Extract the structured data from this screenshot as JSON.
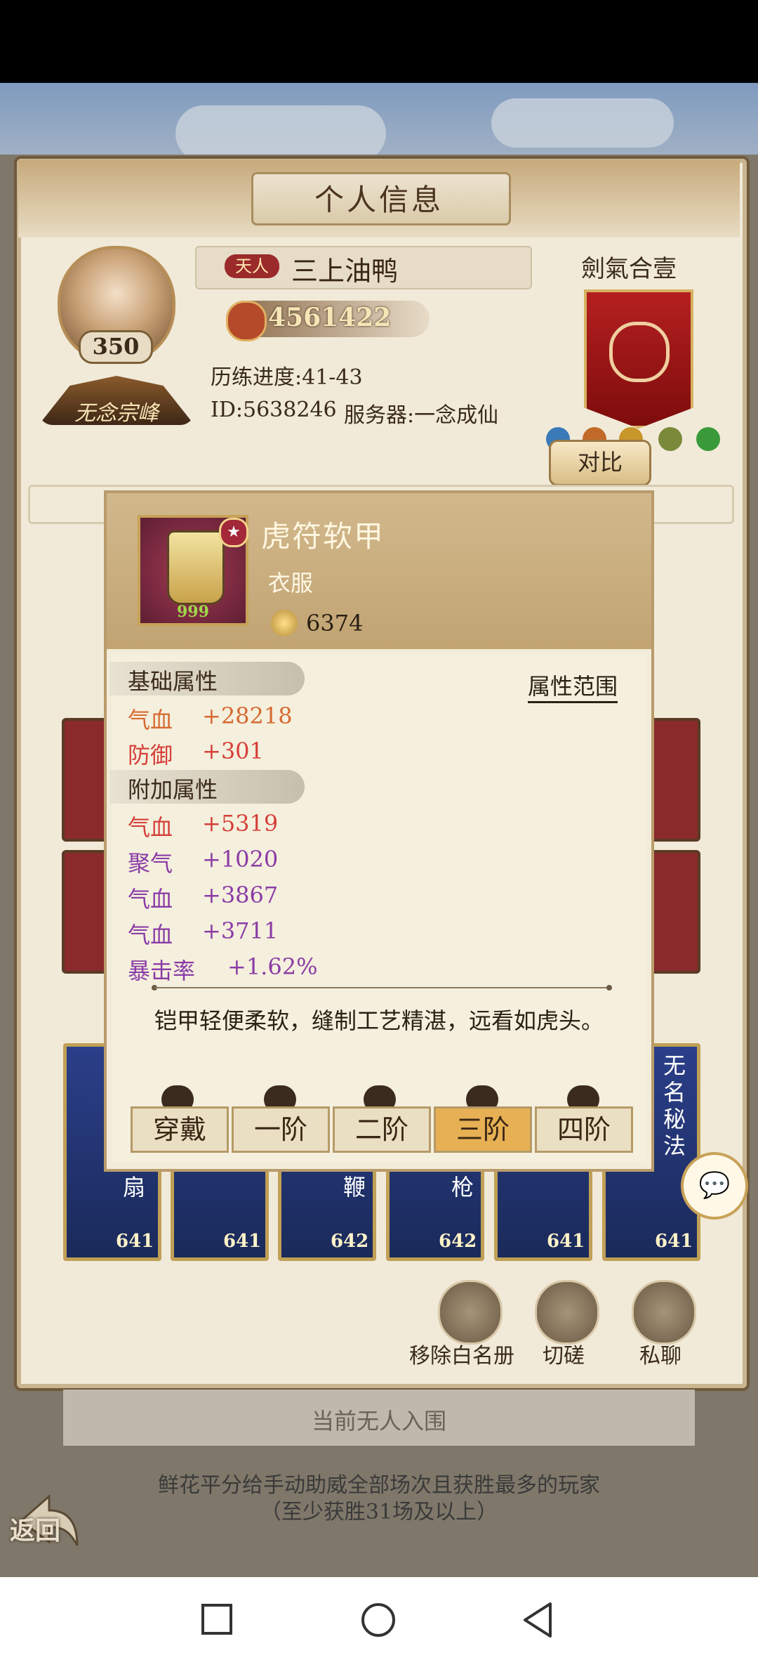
{
  "header": {
    "title": "个人信息"
  },
  "profile": {
    "level": "350",
    "sect": "无念宗峰",
    "title_badge": "天人",
    "name": "三上油鸭",
    "power": "4561422",
    "progress": "历练进度:41-43",
    "id": "ID:5638246",
    "server": "服务器:一念成仙"
  },
  "guild": {
    "name": "劍氣合壹",
    "compare_label": "对比"
  },
  "item": {
    "name": "虎符软甲",
    "type": "衣服",
    "price": "6374",
    "level_badge": "999",
    "base_title": "基础属性",
    "range_label": "属性范围",
    "base_stats": [
      {
        "name": "气血",
        "value": "+28218",
        "color": "#d66a32"
      },
      {
        "name": "防御",
        "value": "+301",
        "color": "#d6403a"
      }
    ],
    "extra_title": "附加属性",
    "extra_stats": [
      {
        "name": "气血",
        "value": "+5319",
        "color": "#d4403a"
      },
      {
        "name": "聚气",
        "value": "+1020",
        "color": "#8a3ca6"
      },
      {
        "name": "气血",
        "value": "+3867",
        "color": "#8a3ca6"
      },
      {
        "name": "气血",
        "value": "+3711",
        "color": "#8a3ca6"
      },
      {
        "name": "暴击率",
        "value": "+1.62%",
        "color": "#8a3ca6"
      }
    ],
    "description": "铠甲轻便柔软，缝制工艺精湛，远看如虎头。",
    "tiers": [
      {
        "label": "穿戴",
        "active": false
      },
      {
        "label": "一阶",
        "active": false
      },
      {
        "label": "二阶",
        "active": false
      },
      {
        "label": "三阶",
        "active": true
      },
      {
        "label": "四阶",
        "active": false
      }
    ]
  },
  "skills": [
    {
      "label": "扇",
      "level": "641"
    },
    {
      "label": "",
      "level": "641"
    },
    {
      "label": "鞭",
      "level": "642"
    },
    {
      "label": "枪",
      "level": "642"
    },
    {
      "label": "",
      "level": "641"
    },
    {
      "label": "无名秘法",
      "level": "641"
    }
  ],
  "actions": {
    "remove_whitelist": "移除白名册",
    "spar": "切磋",
    "private_chat": "私聊"
  },
  "bottom": {
    "status": "当前无人入围",
    "notice": "鲜花平分给手动助威全部场次且获胜最多的玩家（至少获胜31场及以上）",
    "back_label": "返回"
  },
  "colors": {
    "accent": "#e7b054",
    "panel": "#f1ead9",
    "banner_red": "#b52020"
  }
}
